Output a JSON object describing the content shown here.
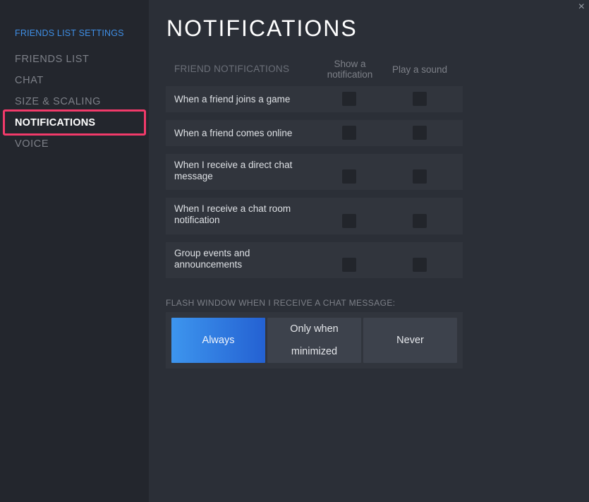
{
  "sidebar": {
    "header": "FRIENDS LIST SETTINGS",
    "items": [
      {
        "label": "FRIENDS LIST",
        "active": false
      },
      {
        "label": "CHAT",
        "active": false
      },
      {
        "label": "SIZE & SCALING",
        "active": false
      },
      {
        "label": "NOTIFICATIONS",
        "active": true
      },
      {
        "label": "VOICE",
        "active": false
      }
    ]
  },
  "window": {
    "close_icon": "×"
  },
  "main": {
    "title": "NOTIFICATIONS",
    "section_label": "FRIEND NOTIFICATIONS",
    "columns": {
      "show": "Show a notification",
      "sound": "Play a sound"
    },
    "rows": [
      {
        "label": "When a friend joins a game",
        "show": false,
        "sound": false
      },
      {
        "label": "When a friend comes online",
        "show": false,
        "sound": false
      },
      {
        "label": "When I receive a direct chat message",
        "show": false,
        "sound": false
      },
      {
        "label": "When I receive a chat room notification",
        "show": false,
        "sound": false
      },
      {
        "label": "Group events and announcements",
        "show": false,
        "sound": false
      }
    ],
    "flash": {
      "label": "FLASH WINDOW WHEN I RECEIVE A CHAT MESSAGE:",
      "options": [
        {
          "label": "Always",
          "selected": true
        },
        {
          "label": "Only when minimized",
          "selected": false
        },
        {
          "label": "Never",
          "selected": false
        }
      ]
    }
  }
}
